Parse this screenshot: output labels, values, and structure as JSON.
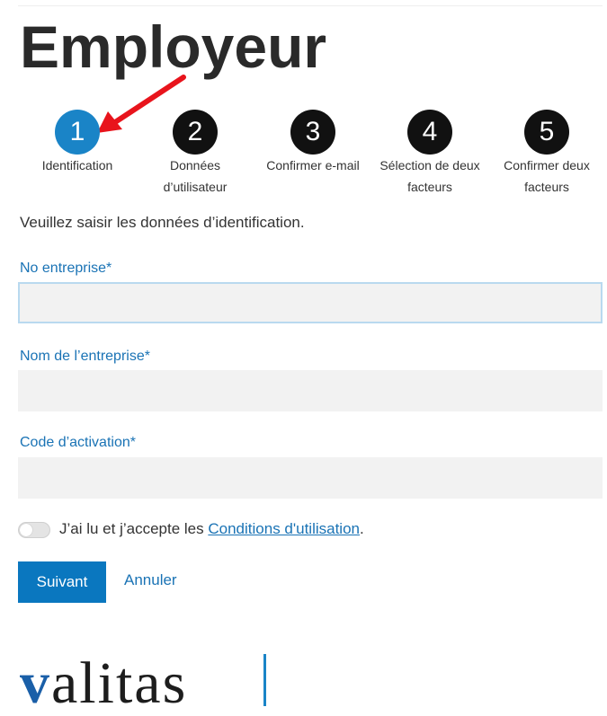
{
  "page": {
    "title": "Employeur",
    "intro": "Veuillez saisir les données d’identification."
  },
  "steps": [
    {
      "number": "1",
      "label": "Identification",
      "active": true
    },
    {
      "number": "2",
      "label": "Données d’utilisateur",
      "active": false
    },
    {
      "number": "3",
      "label": "Confirmer e-mail",
      "active": false
    },
    {
      "number": "4",
      "label": "Sélection de deux facteurs",
      "active": false
    },
    {
      "number": "5",
      "label": "Confirmer deux facteurs",
      "active": false
    }
  ],
  "form": {
    "company_number": {
      "label": "No entreprise*",
      "value": ""
    },
    "company_name": {
      "label": "Nom de l’entreprise*",
      "value": ""
    },
    "activation_code": {
      "label": "Code d’activation*",
      "value": ""
    },
    "terms": {
      "checked": false,
      "prefix": "J’ai lu et j’accepte les ",
      "link": "Conditions d'utilisation",
      "suffix": "."
    }
  },
  "actions": {
    "next": "Suivant",
    "cancel": "Annuler"
  },
  "brand": {
    "logo_v": "v",
    "logo_rest": "alitas"
  },
  "colors": {
    "accent": "#1a84c7",
    "button": "#0a77bf",
    "arrow": "#e8141c"
  }
}
